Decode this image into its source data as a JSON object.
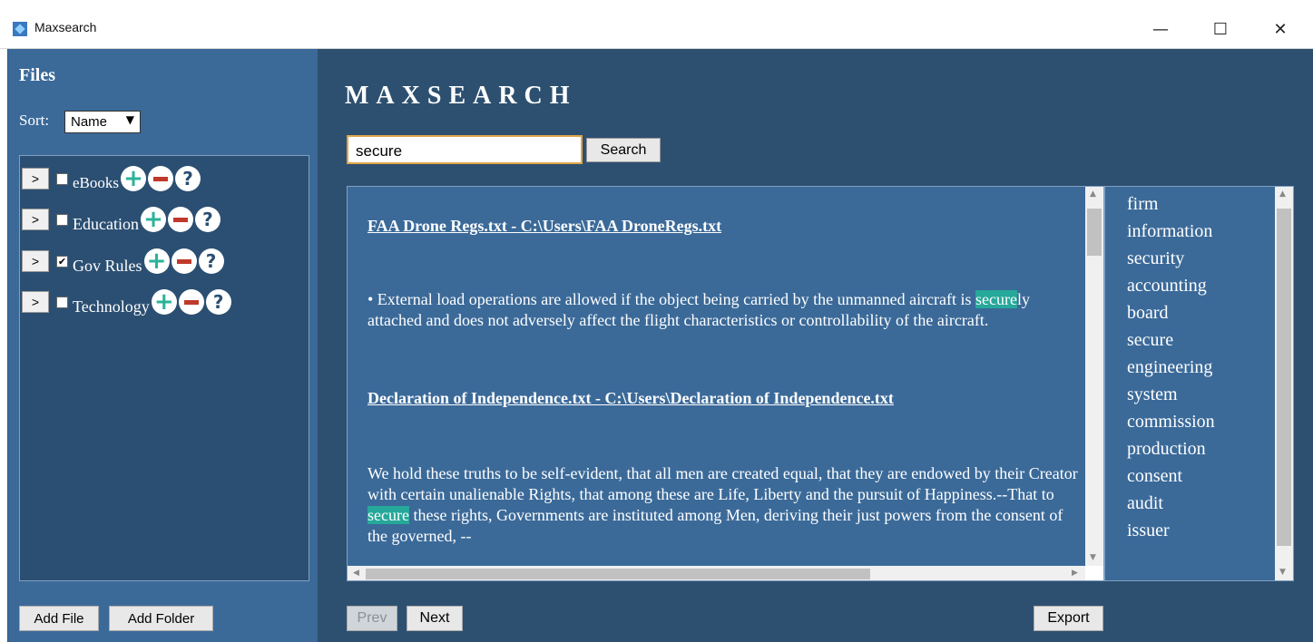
{
  "window": {
    "title": "Maxsearch",
    "controls": {
      "minimize": "—",
      "maximize": "☐",
      "close": "✕"
    }
  },
  "sidebar": {
    "heading": "Files",
    "sort_label": "Sort:",
    "sort_value": "Name",
    "sort_arrow": "▼",
    "folders": [
      {
        "label": "eBooks",
        "checked": false,
        "expand": ">",
        "check_mark": ""
      },
      {
        "label": "Education",
        "checked": false,
        "expand": ">",
        "check_mark": ""
      },
      {
        "label": "Gov Rules",
        "checked": true,
        "expand": ">",
        "check_mark": "✔"
      },
      {
        "label": "Technology",
        "checked": false,
        "expand": ">",
        "check_mark": ""
      }
    ],
    "folder_actions": {
      "add": "+",
      "help": "?"
    },
    "add_file_label": "Add File",
    "add_folder_label": "Add Folder"
  },
  "main": {
    "title": "MAXSEARCH",
    "search_value": "secure",
    "search_button": "Search",
    "results": [
      {
        "link": "FAA Drone Regs.txt - C:\\Users\\FAA DroneRegs.txt",
        "pre": "• External load operations are allowed if the object being carried by the unmanned aircraft is ",
        "match": "secure",
        "post": "ly attached and does not adversely affect the flight characteristics or controllability of the aircraft."
      },
      {
        "link": "Declaration of Independence.txt - C:\\Users\\Declaration of Independence.txt",
        "pre": "We hold these truths to be self-evident, that all men are created equal, that they are endowed by their Creator with certain unalienable Rights, that among these are Life, Liberty and the pursuit of Happiness.--That to ",
        "match": "secure",
        "post": " these rights, Governments are instituted among Men, deriving their just powers from the consent of the governed, --"
      }
    ],
    "keywords": [
      "firm",
      "information",
      "security",
      "accounting",
      "board",
      "secure",
      "engineering",
      "system",
      "commission",
      "production",
      "consent",
      "audit",
      "issuer"
    ],
    "prev_label": "Prev",
    "next_label": "Next",
    "export_label": "Export"
  },
  "colors": {
    "sidebar_bg": "#3b6a99",
    "main_bg": "#2d5070",
    "highlight": "#26a89a",
    "add_icon": "#2bb39a",
    "remove_icon": "#c0392b"
  }
}
